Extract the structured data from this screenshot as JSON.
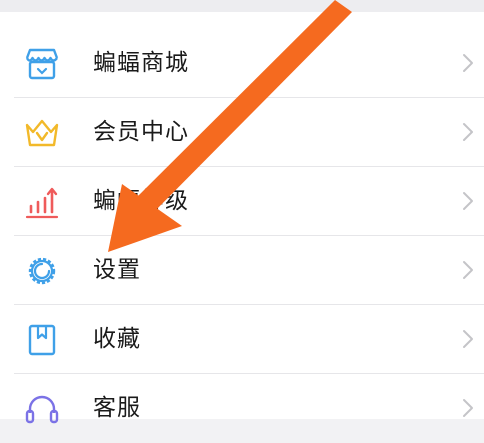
{
  "menu": {
    "items": [
      {
        "label": "蝙蝠商城",
        "icon": "shop-icon"
      },
      {
        "label": "会员中心",
        "icon": "crown-icon"
      },
      {
        "label": "蝙蝠等级",
        "icon": "level-chart-icon"
      },
      {
        "label": "设置",
        "icon": "gear-icon"
      },
      {
        "label": "收藏",
        "icon": "bookmark-icon"
      },
      {
        "label": "客服",
        "icon": "headset-icon"
      }
    ]
  },
  "colors": {
    "icon_blue": "#3fa0e8",
    "icon_gold": "#f2b92a",
    "icon_red": "#ef5b5b",
    "icon_purple": "#7b72e6",
    "arrow_orange": "#f56a1f",
    "chevron": "#c4c4c8"
  }
}
